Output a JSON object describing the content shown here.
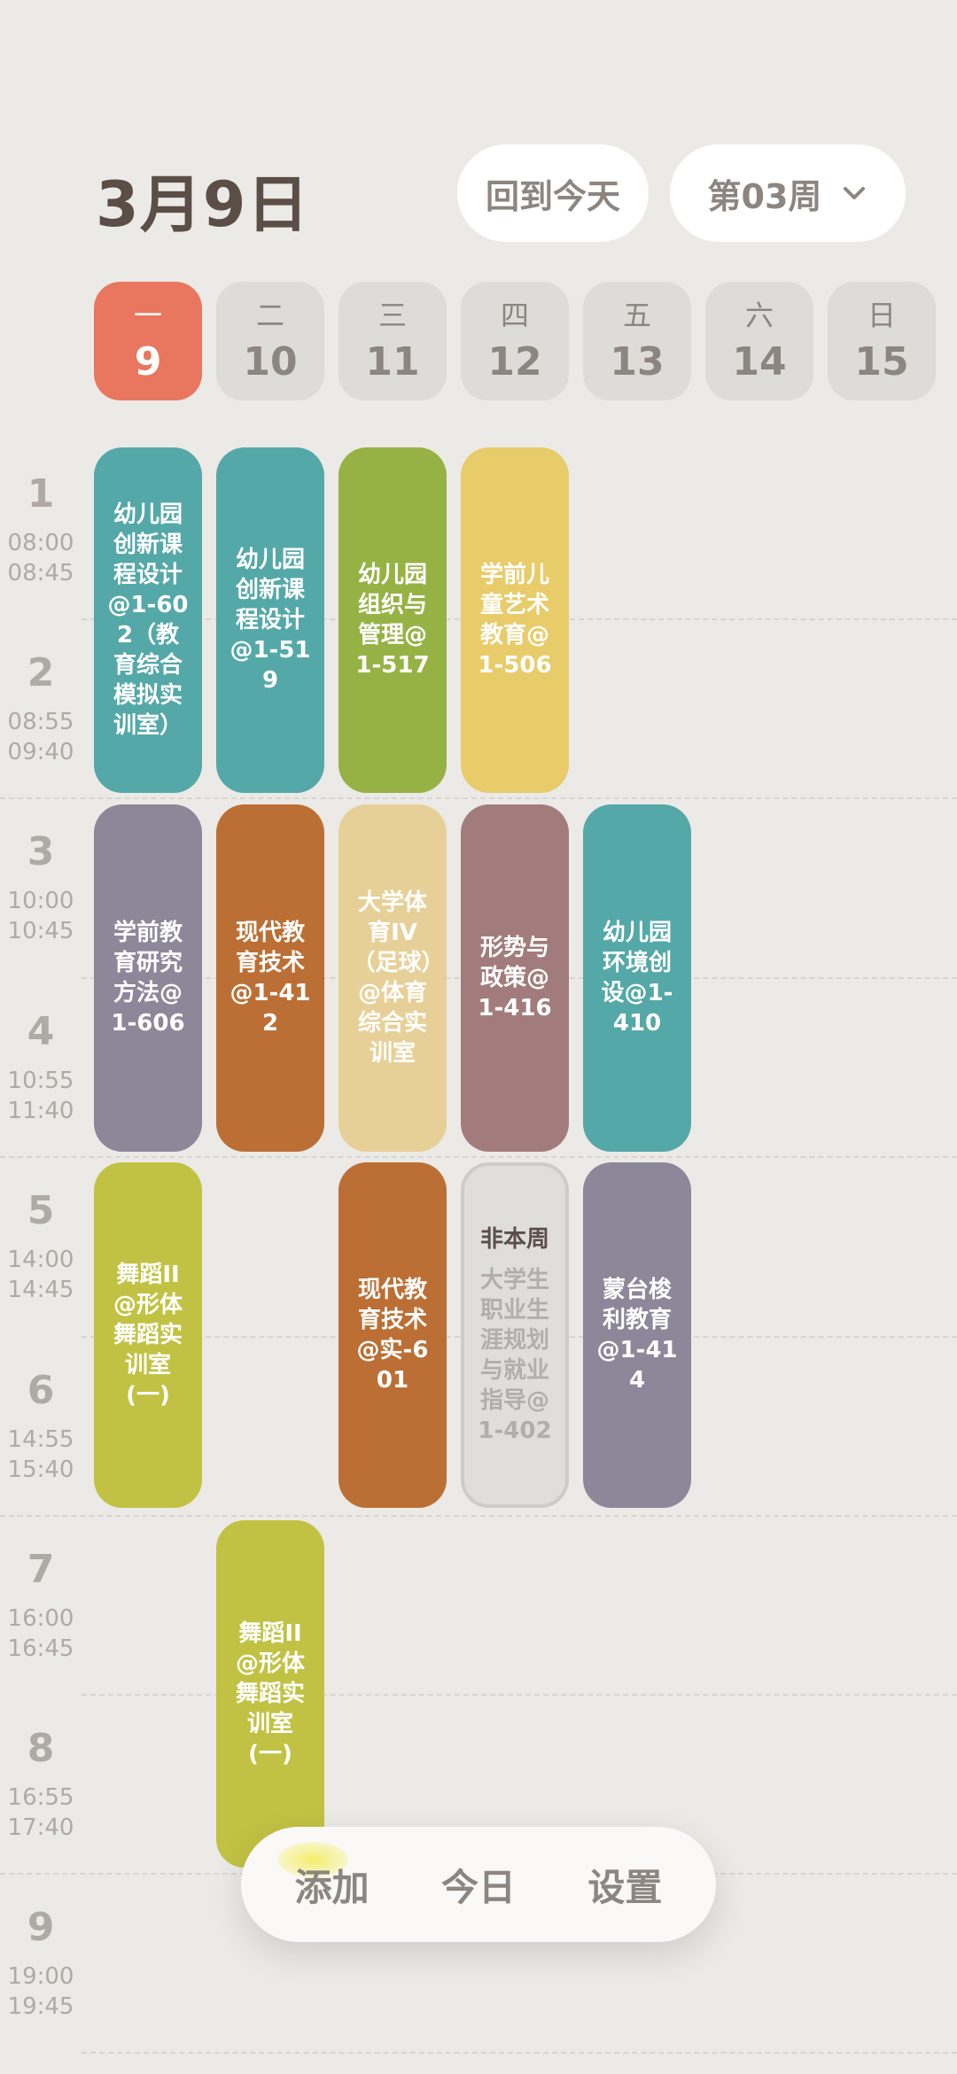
{
  "header": {
    "date_title": "3月9日",
    "today_button": "回到今天",
    "week_selector": "第03周"
  },
  "days": [
    {
      "weekday": "一",
      "date": "9",
      "active": true
    },
    {
      "weekday": "二",
      "date": "10"
    },
    {
      "weekday": "三",
      "date": "11"
    },
    {
      "weekday": "四",
      "date": "12"
    },
    {
      "weekday": "五",
      "date": "13"
    },
    {
      "weekday": "六",
      "date": "14"
    },
    {
      "weekday": "日",
      "date": "15"
    }
  ],
  "periods": [
    {
      "num": "1",
      "start": "08:00",
      "end": "08:45"
    },
    {
      "num": "2",
      "start": "08:55",
      "end": "09:40"
    },
    {
      "num": "3",
      "start": "10:00",
      "end": "10:45"
    },
    {
      "num": "4",
      "start": "10:55",
      "end": "11:40"
    },
    {
      "num": "5",
      "start": "14:00",
      "end": "14:45"
    },
    {
      "num": "6",
      "start": "14:55",
      "end": "15:40"
    },
    {
      "num": "7",
      "start": "16:00",
      "end": "16:45"
    },
    {
      "num": "8",
      "start": "16:55",
      "end": "17:40"
    },
    {
      "num": "9",
      "start": "19:00",
      "end": "19:45"
    }
  ],
  "courses": {
    "mon_12": "幼儿园创新课程设计@1-602（教育综合模拟实训室）",
    "tue_12": "幼儿园创新课程设计@1-519",
    "wed_12": "幼儿园组织与管理@1-517",
    "thu_12": "学前儿童艺术教育@1-506",
    "mon_34": "学前教育研究方法@1-606",
    "tue_34": "现代教育技术@1-412",
    "wed_34": "大学体育IV（足球）@体育综合实训室",
    "thu_34": "形势与政策@1-416",
    "fri_34": "幼儿园环境创设@1-410",
    "mon_56": "舞蹈II@形体舞蹈实训室(一)",
    "wed_56": "现代教育技术@实-601",
    "thu_56_tag": "非本周",
    "thu_56": "大学生职业生涯规划与就业指导@1-402",
    "fri_56": "蒙台梭利教育@1-414",
    "tue_78": "舞蹈II@形体舞蹈实训室(一)"
  },
  "colors": {
    "teal": "#55A8A8",
    "green": "#97B244",
    "yellow": "#E8CC6A",
    "gray_purple": "#8C889A",
    "orange": "#BC6F34",
    "sand": "#E7D098",
    "rose": "#A27C7C",
    "lime": "#C1C243",
    "today": "#E9765E"
  },
  "bottom_nav": {
    "add": "添加",
    "today": "今日",
    "settings": "设置"
  }
}
